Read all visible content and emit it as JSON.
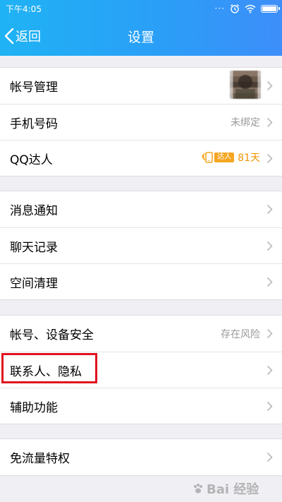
{
  "status_bar": {
    "time": "下午4:05",
    "signal_dots": "···",
    "battery_level": 0.92
  },
  "header": {
    "back_label": "返回",
    "title": "设置"
  },
  "groups": [
    {
      "items": [
        {
          "label": "帐号管理",
          "value": ""
        },
        {
          "label": "手机号码",
          "value": "未绑定"
        },
        {
          "label": "QQ达人",
          "badge": "达人",
          "value": "81天"
        }
      ]
    },
    {
      "items": [
        {
          "label": "消息通知",
          "value": ""
        },
        {
          "label": "聊天记录",
          "value": ""
        },
        {
          "label": "空间清理",
          "value": ""
        }
      ]
    },
    {
      "items": [
        {
          "label": "帐号、设备安全",
          "value": "存在风险"
        },
        {
          "label": "联系人、隐私",
          "value": ""
        },
        {
          "label": "辅助功能",
          "value": ""
        }
      ]
    },
    {
      "items": [
        {
          "label": "免流量特权",
          "value": ""
        }
      ]
    }
  ],
  "watermark": {
    "text": "Bai 经验"
  },
  "colors": {
    "header_start": "#1fb3f4",
    "header_end": "#3d8ef9",
    "background": "#efeff4",
    "highlight": "#e0121f",
    "accent_orange": "#f29400"
  }
}
